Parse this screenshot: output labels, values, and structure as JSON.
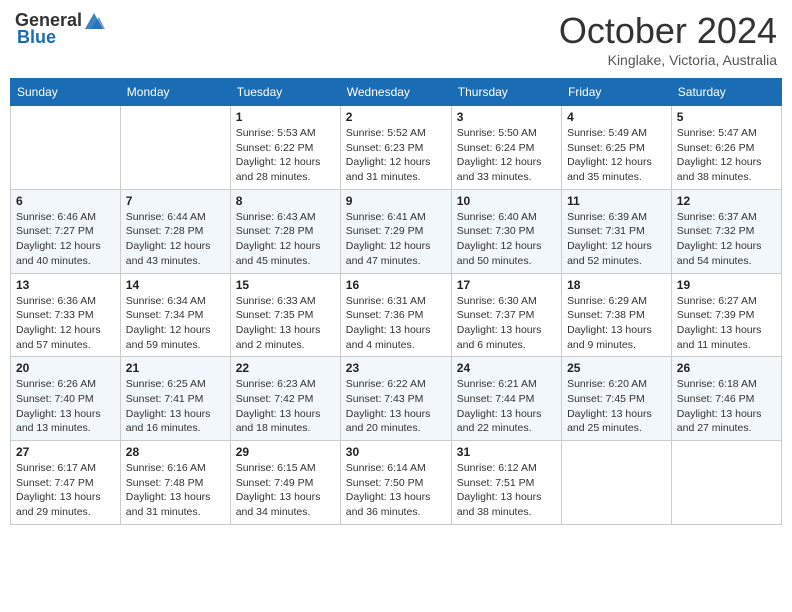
{
  "header": {
    "logo_general": "General",
    "logo_blue": "Blue",
    "month": "October 2024",
    "location": "Kinglake, Victoria, Australia"
  },
  "days_of_week": [
    "Sunday",
    "Monday",
    "Tuesday",
    "Wednesday",
    "Thursday",
    "Friday",
    "Saturday"
  ],
  "weeks": [
    [
      {
        "day": "",
        "sunrise": "",
        "sunset": "",
        "daylight": ""
      },
      {
        "day": "",
        "sunrise": "",
        "sunset": "",
        "daylight": ""
      },
      {
        "day": "1",
        "sunrise": "Sunrise: 5:53 AM",
        "sunset": "Sunset: 6:22 PM",
        "daylight": "Daylight: 12 hours and 28 minutes."
      },
      {
        "day": "2",
        "sunrise": "Sunrise: 5:52 AM",
        "sunset": "Sunset: 6:23 PM",
        "daylight": "Daylight: 12 hours and 31 minutes."
      },
      {
        "day": "3",
        "sunrise": "Sunrise: 5:50 AM",
        "sunset": "Sunset: 6:24 PM",
        "daylight": "Daylight: 12 hours and 33 minutes."
      },
      {
        "day": "4",
        "sunrise": "Sunrise: 5:49 AM",
        "sunset": "Sunset: 6:25 PM",
        "daylight": "Daylight: 12 hours and 35 minutes."
      },
      {
        "day": "5",
        "sunrise": "Sunrise: 5:47 AM",
        "sunset": "Sunset: 6:26 PM",
        "daylight": "Daylight: 12 hours and 38 minutes."
      }
    ],
    [
      {
        "day": "6",
        "sunrise": "Sunrise: 6:46 AM",
        "sunset": "Sunset: 7:27 PM",
        "daylight": "Daylight: 12 hours and 40 minutes."
      },
      {
        "day": "7",
        "sunrise": "Sunrise: 6:44 AM",
        "sunset": "Sunset: 7:28 PM",
        "daylight": "Daylight: 12 hours and 43 minutes."
      },
      {
        "day": "8",
        "sunrise": "Sunrise: 6:43 AM",
        "sunset": "Sunset: 7:28 PM",
        "daylight": "Daylight: 12 hours and 45 minutes."
      },
      {
        "day": "9",
        "sunrise": "Sunrise: 6:41 AM",
        "sunset": "Sunset: 7:29 PM",
        "daylight": "Daylight: 12 hours and 47 minutes."
      },
      {
        "day": "10",
        "sunrise": "Sunrise: 6:40 AM",
        "sunset": "Sunset: 7:30 PM",
        "daylight": "Daylight: 12 hours and 50 minutes."
      },
      {
        "day": "11",
        "sunrise": "Sunrise: 6:39 AM",
        "sunset": "Sunset: 7:31 PM",
        "daylight": "Daylight: 12 hours and 52 minutes."
      },
      {
        "day": "12",
        "sunrise": "Sunrise: 6:37 AM",
        "sunset": "Sunset: 7:32 PM",
        "daylight": "Daylight: 12 hours and 54 minutes."
      }
    ],
    [
      {
        "day": "13",
        "sunrise": "Sunrise: 6:36 AM",
        "sunset": "Sunset: 7:33 PM",
        "daylight": "Daylight: 12 hours and 57 minutes."
      },
      {
        "day": "14",
        "sunrise": "Sunrise: 6:34 AM",
        "sunset": "Sunset: 7:34 PM",
        "daylight": "Daylight: 12 hours and 59 minutes."
      },
      {
        "day": "15",
        "sunrise": "Sunrise: 6:33 AM",
        "sunset": "Sunset: 7:35 PM",
        "daylight": "Daylight: 13 hours and 2 minutes."
      },
      {
        "day": "16",
        "sunrise": "Sunrise: 6:31 AM",
        "sunset": "Sunset: 7:36 PM",
        "daylight": "Daylight: 13 hours and 4 minutes."
      },
      {
        "day": "17",
        "sunrise": "Sunrise: 6:30 AM",
        "sunset": "Sunset: 7:37 PM",
        "daylight": "Daylight: 13 hours and 6 minutes."
      },
      {
        "day": "18",
        "sunrise": "Sunrise: 6:29 AM",
        "sunset": "Sunset: 7:38 PM",
        "daylight": "Daylight: 13 hours and 9 minutes."
      },
      {
        "day": "19",
        "sunrise": "Sunrise: 6:27 AM",
        "sunset": "Sunset: 7:39 PM",
        "daylight": "Daylight: 13 hours and 11 minutes."
      }
    ],
    [
      {
        "day": "20",
        "sunrise": "Sunrise: 6:26 AM",
        "sunset": "Sunset: 7:40 PM",
        "daylight": "Daylight: 13 hours and 13 minutes."
      },
      {
        "day": "21",
        "sunrise": "Sunrise: 6:25 AM",
        "sunset": "Sunset: 7:41 PM",
        "daylight": "Daylight: 13 hours and 16 minutes."
      },
      {
        "day": "22",
        "sunrise": "Sunrise: 6:23 AM",
        "sunset": "Sunset: 7:42 PM",
        "daylight": "Daylight: 13 hours and 18 minutes."
      },
      {
        "day": "23",
        "sunrise": "Sunrise: 6:22 AM",
        "sunset": "Sunset: 7:43 PM",
        "daylight": "Daylight: 13 hours and 20 minutes."
      },
      {
        "day": "24",
        "sunrise": "Sunrise: 6:21 AM",
        "sunset": "Sunset: 7:44 PM",
        "daylight": "Daylight: 13 hours and 22 minutes."
      },
      {
        "day": "25",
        "sunrise": "Sunrise: 6:20 AM",
        "sunset": "Sunset: 7:45 PM",
        "daylight": "Daylight: 13 hours and 25 minutes."
      },
      {
        "day": "26",
        "sunrise": "Sunrise: 6:18 AM",
        "sunset": "Sunset: 7:46 PM",
        "daylight": "Daylight: 13 hours and 27 minutes."
      }
    ],
    [
      {
        "day": "27",
        "sunrise": "Sunrise: 6:17 AM",
        "sunset": "Sunset: 7:47 PM",
        "daylight": "Daylight: 13 hours and 29 minutes."
      },
      {
        "day": "28",
        "sunrise": "Sunrise: 6:16 AM",
        "sunset": "Sunset: 7:48 PM",
        "daylight": "Daylight: 13 hours and 31 minutes."
      },
      {
        "day": "29",
        "sunrise": "Sunrise: 6:15 AM",
        "sunset": "Sunset: 7:49 PM",
        "daylight": "Daylight: 13 hours and 34 minutes."
      },
      {
        "day": "30",
        "sunrise": "Sunrise: 6:14 AM",
        "sunset": "Sunset: 7:50 PM",
        "daylight": "Daylight: 13 hours and 36 minutes."
      },
      {
        "day": "31",
        "sunrise": "Sunrise: 6:12 AM",
        "sunset": "Sunset: 7:51 PM",
        "daylight": "Daylight: 13 hours and 38 minutes."
      },
      {
        "day": "",
        "sunrise": "",
        "sunset": "",
        "daylight": ""
      },
      {
        "day": "",
        "sunrise": "",
        "sunset": "",
        "daylight": ""
      }
    ]
  ]
}
